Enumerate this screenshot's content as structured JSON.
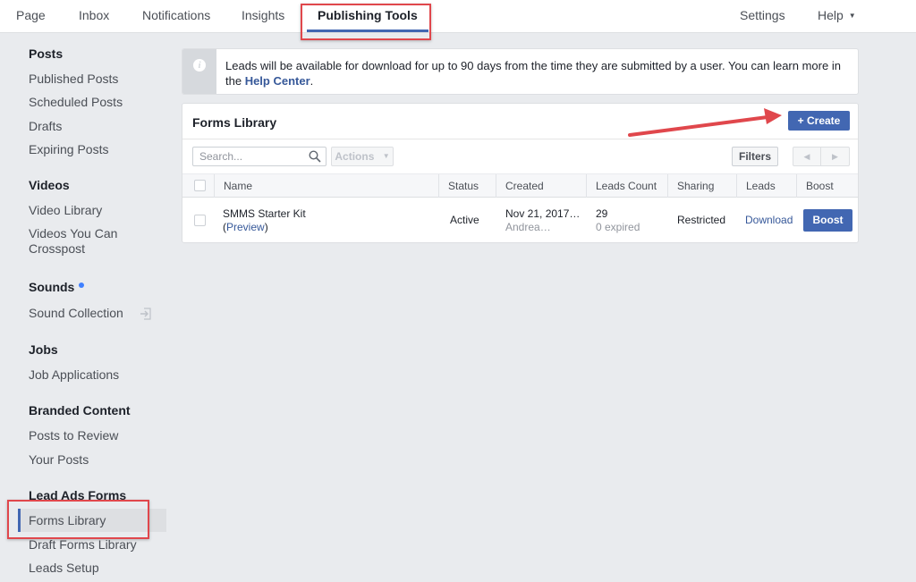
{
  "topnav": {
    "tabs": [
      {
        "label": "Page"
      },
      {
        "label": "Inbox"
      },
      {
        "label": "Notifications"
      },
      {
        "label": "Insights"
      },
      {
        "label": "Publishing Tools",
        "active": true
      }
    ],
    "settings_label": "Settings",
    "help_label": "Help",
    "help_caret": "▼"
  },
  "sidebar": {
    "sections": [
      {
        "heading": "Posts",
        "items": [
          "Published Posts",
          "Scheduled Posts",
          "Drafts",
          "Expiring Posts"
        ]
      },
      {
        "heading": "Videos",
        "items": [
          "Video Library",
          "Videos You Can Crosspost"
        ]
      },
      {
        "heading": "Sounds",
        "new_badge": true,
        "items": [
          "Sound Collection"
        ]
      },
      {
        "heading": "Jobs",
        "items": [
          "Job Applications"
        ]
      },
      {
        "heading": "Branded Content",
        "items": [
          "Posts to Review",
          "Your Posts"
        ]
      },
      {
        "heading": "Lead Ads Forms",
        "items": [
          "Forms Library",
          "Draft Forms Library",
          "Leads Setup"
        ],
        "selected": "Forms Library"
      }
    ],
    "video_crosspost_line1": "Videos You Can",
    "video_crosspost_line2": "Crosspost"
  },
  "banner": {
    "icon": "info-icon",
    "text_before": "Leads will be available for download for up to 90 days from the time they are submitted by a user. You can learn more in the ",
    "link_label": "Help Center",
    "text_after": "."
  },
  "forms_library": {
    "title": "Forms Library",
    "create_label": "+ Create",
    "search_placeholder": "Search...",
    "actions_label": "Actions",
    "actions_caret": "▼",
    "filters_label": "Filters",
    "pager_prev": "◀",
    "pager_next": "▶",
    "columns": [
      "Name",
      "Status",
      "Created",
      "Leads Count",
      "Sharing",
      "Leads",
      "Boost"
    ],
    "rows": [
      {
        "name": "SMMS Starter Kit",
        "preview_label": "Preview",
        "status": "Active",
        "created_date": "Nov 21, 2017…",
        "created_by": "Andrea…",
        "leads_count": "29",
        "leads_expired": "0 expired",
        "sharing": "Restricted",
        "leads_action": "Download",
        "boost_label": "Boost"
      }
    ]
  },
  "colors": {
    "accent": "#4267b2",
    "link": "#365899",
    "annotation_red": "#e0474c",
    "background": "#e9ebee"
  }
}
